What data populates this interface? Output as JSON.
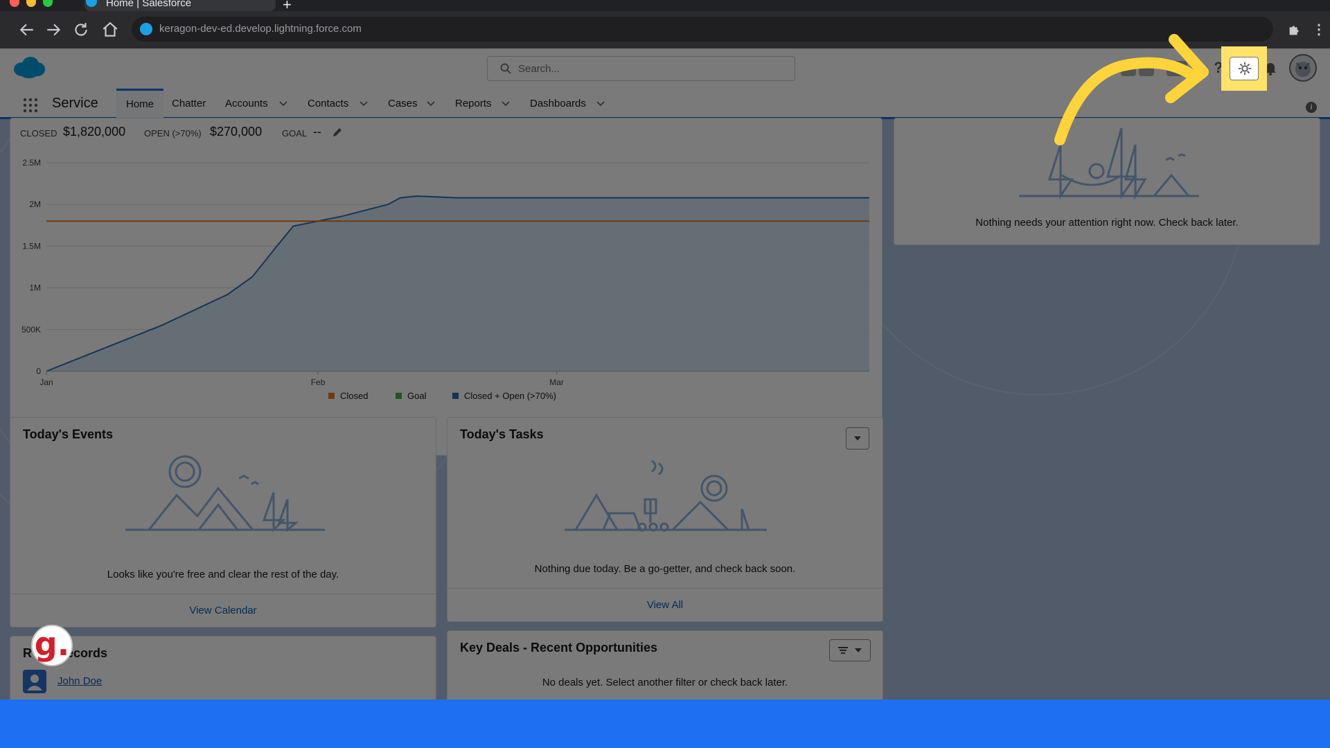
{
  "browser": {
    "tab_title": "Home | Salesforce",
    "new_tab": "+",
    "url": "keragon-dev-ed.develop.lightning.force.com"
  },
  "header": {
    "search_placeholder": "Search..."
  },
  "nav": {
    "app_name": "Service",
    "items": [
      {
        "label": "Home"
      },
      {
        "label": "Chatter"
      },
      {
        "label": "Accounts"
      },
      {
        "label": "Contacts"
      },
      {
        "label": "Cases"
      },
      {
        "label": "Reports"
      },
      {
        "label": "Dashboards"
      }
    ]
  },
  "performance": {
    "closed_label": "CLOSED",
    "closed_value": "$1,820,000",
    "open_label": "OPEN (>70%)",
    "open_value": "$270,000",
    "goal_label": "GOAL",
    "goal_value": "--"
  },
  "chart_data": {
    "type": "line",
    "x_ticks": [
      "Jan",
      "Feb",
      "Mar"
    ],
    "y_ticks": [
      "2.5M",
      "2M",
      "1.5M",
      "1M",
      "500K",
      "0"
    ],
    "ylim": [
      0,
      2500000
    ],
    "legend": [
      {
        "name": "Closed",
        "color": "#e87722"
      },
      {
        "name": "Goal",
        "color": "#4bab48"
      },
      {
        "name": "Closed + Open (>70%)",
        "color": "#2a6fb0"
      }
    ],
    "series": [
      {
        "name": "Closed",
        "type": "flat-line",
        "value": 1800000
      },
      {
        "name": "Closed + Open (>70%)",
        "type": "area",
        "points": [
          {
            "x": 0.0,
            "y": 0
          },
          {
            "x": 0.14,
            "y": 550000
          },
          {
            "x": 0.22,
            "y": 920000
          },
          {
            "x": 0.25,
            "y": 1130000
          },
          {
            "x": 0.28,
            "y": 1500000
          },
          {
            "x": 0.3,
            "y": 1740000
          },
          {
            "x": 0.36,
            "y": 1860000
          },
          {
            "x": 0.415,
            "y": 2000000
          },
          {
            "x": 0.43,
            "y": 2080000
          },
          {
            "x": 0.45,
            "y": 2100000
          },
          {
            "x": 0.5,
            "y": 2080000
          },
          {
            "x": 1.0,
            "y": 2080000
          }
        ]
      }
    ]
  },
  "attention": {
    "message": "Nothing needs your attention right now. Check back later."
  },
  "events": {
    "title": "Today's Events",
    "message": "Looks like you're free and clear the rest of the day.",
    "link": "View Calendar"
  },
  "tasks": {
    "title": "Today's Tasks",
    "message": "Nothing due today. Be a go-getter, and check back soon.",
    "link": "View All"
  },
  "records": {
    "title": "Recent Records",
    "title_visible_start": "R",
    "title_visible_end": "ecords",
    "items": [
      {
        "name": "John Doe"
      }
    ]
  },
  "deals": {
    "title": "Key Deals - Recent Opportunities",
    "message": "No deals yet. Select another filter or check back later."
  },
  "badge": {
    "letter": "g."
  },
  "colors": {
    "brand_blue": "#1b6bd2",
    "highlight_yellow": "#ffe26a",
    "arrow_yellow": "#ffd43b",
    "bottom_band": "#1e6ff2"
  },
  "icons": {
    "highlighted": "gear-icon"
  }
}
